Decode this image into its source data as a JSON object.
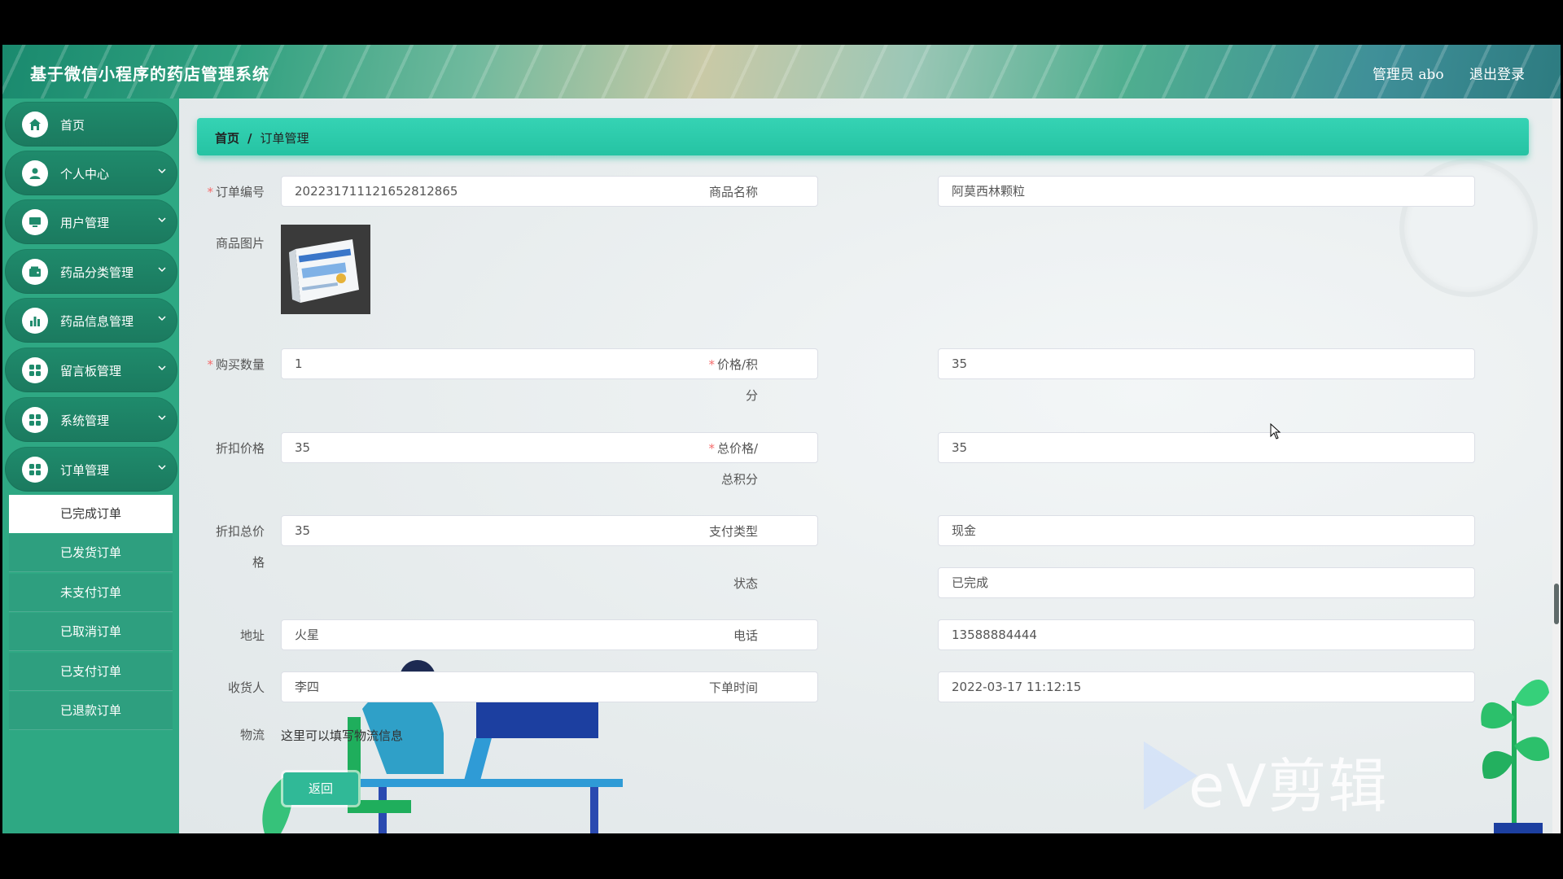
{
  "header": {
    "title": "基于微信小程序的药店管理系统",
    "user": "管理员 abo",
    "logout": "退出登录"
  },
  "sidebar": {
    "items": [
      {
        "label": "首页",
        "icon": "home-icon"
      },
      {
        "label": "个人中心",
        "icon": "user-icon"
      },
      {
        "label": "用户管理",
        "icon": "monitor-icon"
      },
      {
        "label": "药品分类管理",
        "icon": "wallet-icon"
      },
      {
        "label": "药品信息管理",
        "icon": "bar-chart-icon"
      },
      {
        "label": "留言板管理",
        "icon": "grid-icon"
      },
      {
        "label": "系统管理",
        "icon": "grid-icon"
      },
      {
        "label": "订单管理",
        "icon": "grid-icon"
      }
    ],
    "sub_items": [
      "已完成订单",
      "已发货订单",
      "未支付订单",
      "已取消订单",
      "已支付订单",
      "已退款订单"
    ],
    "active_sub": "已完成订单"
  },
  "breadcrumb": {
    "home": "首页",
    "sep": "/",
    "current": "订单管理"
  },
  "form": {
    "order_no": {
      "label": "订单编号",
      "value": "202231711121652812865"
    },
    "product_name": {
      "label": "商品名称",
      "value": "阿莫西林颗粒"
    },
    "product_image": {
      "label": "商品图片"
    },
    "quantity": {
      "label": "购买数量",
      "value": "1"
    },
    "price": {
      "label1": "价格/积",
      "label2": "分",
      "value": "35"
    },
    "discount_price": {
      "label": "折扣价格",
      "value": "35"
    },
    "total_price": {
      "label1": "总价格/",
      "label2": "总积分",
      "value": "35"
    },
    "discount_total": {
      "label1": "折扣总价",
      "label2": "格",
      "value": "35"
    },
    "pay_type": {
      "label": "支付类型",
      "value": "现金"
    },
    "status": {
      "label": "状态",
      "value": "已完成"
    },
    "address": {
      "label": "地址",
      "value": "火星"
    },
    "phone": {
      "label": "电话",
      "value": "13588884444"
    },
    "receiver": {
      "label": "收货人",
      "value": "李四"
    },
    "order_time": {
      "label": "下单时间",
      "value": "2022-03-17 11:12:15"
    },
    "logistics": {
      "label": "物流",
      "value": "这里可以填写物流信息"
    },
    "back_button": "返回"
  },
  "watermark": "eV剪辑",
  "colors": {
    "primary": "#2ea883",
    "accent": "#30cdb0",
    "required": "#f56c6c"
  }
}
